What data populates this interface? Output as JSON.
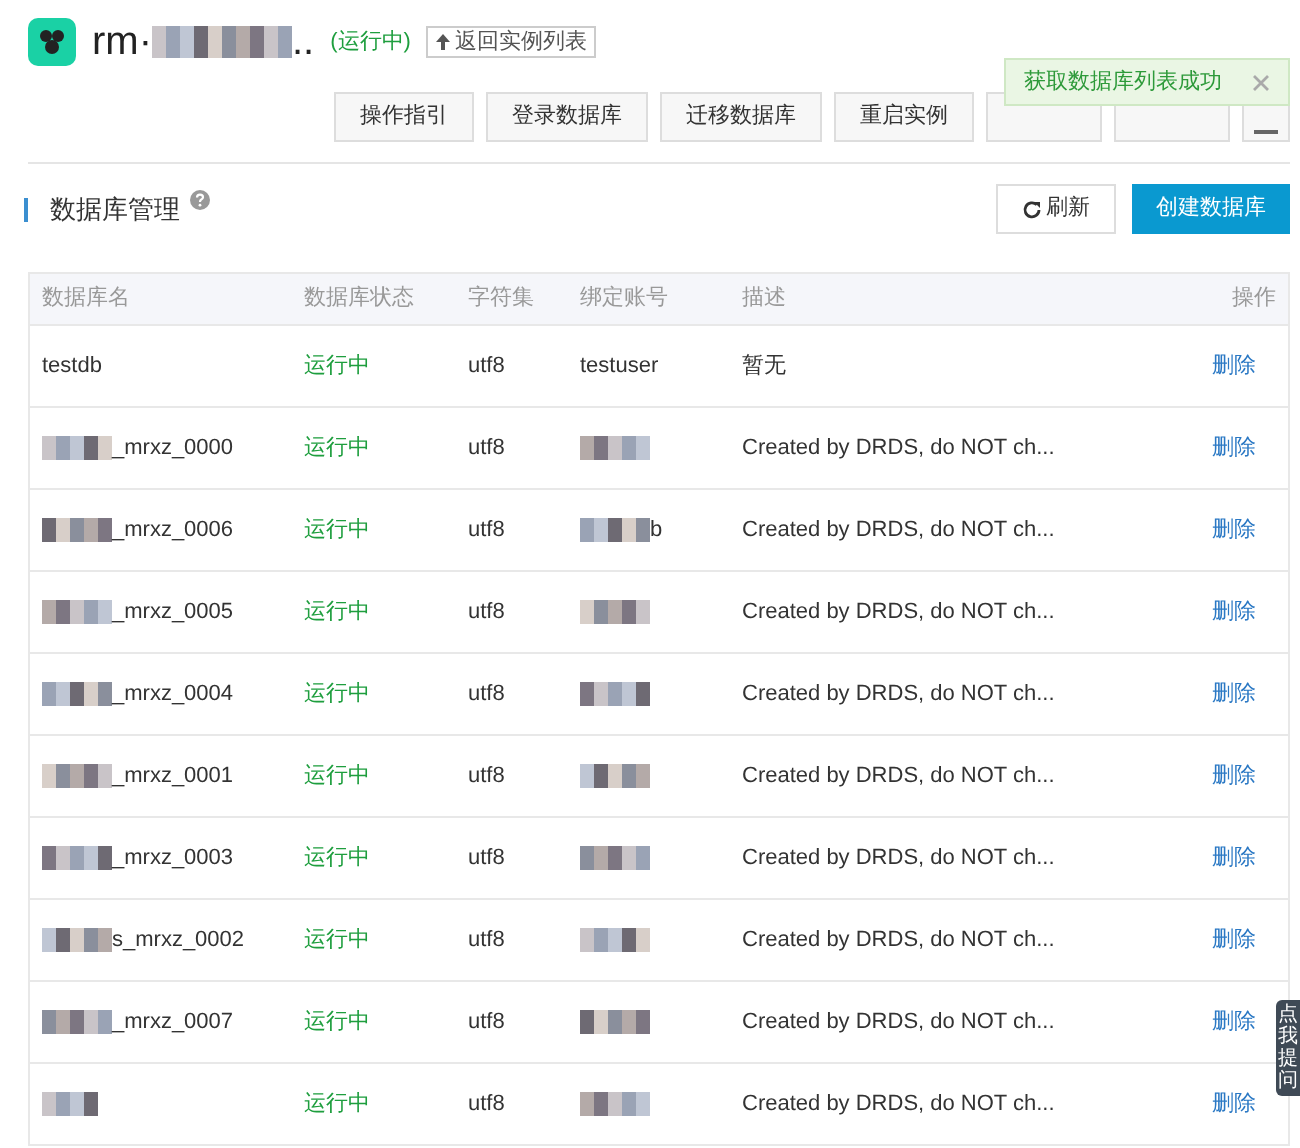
{
  "instance": {
    "title_prefix": "rm·",
    "title_suffix": "..",
    "status": "(运行中)",
    "back_button": "返回实例列表"
  },
  "toolbar": {
    "buttons": [
      {
        "label": "操作指引",
        "kind": "text"
      },
      {
        "label": "登录数据库",
        "kind": "text"
      },
      {
        "label": "迁移数据库",
        "kind": "text"
      },
      {
        "label": "重启实例",
        "kind": "text"
      },
      {
        "kind": "covered"
      },
      {
        "kind": "covered"
      },
      {
        "kind": "menu"
      }
    ]
  },
  "toast": {
    "message": "获取数据库列表成功"
  },
  "section": {
    "title": "数据库管理",
    "refresh_button": "刷新",
    "create_button": "创建数据库"
  },
  "table": {
    "columns": [
      "数据库名",
      "数据库状态",
      "字符集",
      "绑定账号",
      "描述",
      "操作"
    ],
    "rows": [
      {
        "name": "testdb",
        "name_redacted": false,
        "status": "运行中",
        "charset": "utf8",
        "account": "testuser",
        "account_redacted": false,
        "description": "暂无",
        "action": "删除"
      },
      {
        "name": "_mrxz_0000",
        "name_redacted": true,
        "status": "运行中",
        "charset": "utf8",
        "account_redacted": true,
        "description": "Created by DRDS, do NOT ch...",
        "action": "删除"
      },
      {
        "name": "_mrxz_0006",
        "name_redacted": true,
        "status": "运行中",
        "charset": "utf8",
        "account": "b",
        "account_redacted": true,
        "description": "Created by DRDS, do NOT ch...",
        "action": "删除"
      },
      {
        "name": "_mrxz_0005",
        "name_redacted": true,
        "status": "运行中",
        "charset": "utf8",
        "account_redacted": true,
        "description": "Created by DRDS, do NOT ch...",
        "action": "删除"
      },
      {
        "name": "_mrxz_0004",
        "name_redacted": true,
        "status": "运行中",
        "charset": "utf8",
        "account_redacted": true,
        "description": "Created by DRDS, do NOT ch...",
        "action": "删除"
      },
      {
        "name": "_mrxz_0001",
        "name_redacted": true,
        "status": "运行中",
        "charset": "utf8",
        "account_redacted": true,
        "description": "Created by DRDS, do NOT ch...",
        "action": "删除"
      },
      {
        "name": "_mrxz_0003",
        "name_redacted": true,
        "status": "运行中",
        "charset": "utf8",
        "account_redacted": true,
        "description": "Created by DRDS, do NOT ch...",
        "action": "删除"
      },
      {
        "name": "s_mrxz_0002",
        "name_redacted": true,
        "status": "运行中",
        "charset": "utf8",
        "account_redacted": true,
        "description": "Created by DRDS, do NOT ch...",
        "action": "删除"
      },
      {
        "name": "_mrxz_0007",
        "name_redacted": true,
        "status": "运行中",
        "charset": "utf8",
        "account_redacted": true,
        "description": "Created by DRDS, do NOT ch...",
        "action": "删除"
      },
      {
        "name_redacted": true,
        "status": "运行中",
        "charset": "utf8",
        "account_redacted": true,
        "description": "Created by DRDS, do NOT ch...",
        "action": "删除"
      }
    ]
  },
  "side_tab": {
    "label": "点我提问"
  }
}
